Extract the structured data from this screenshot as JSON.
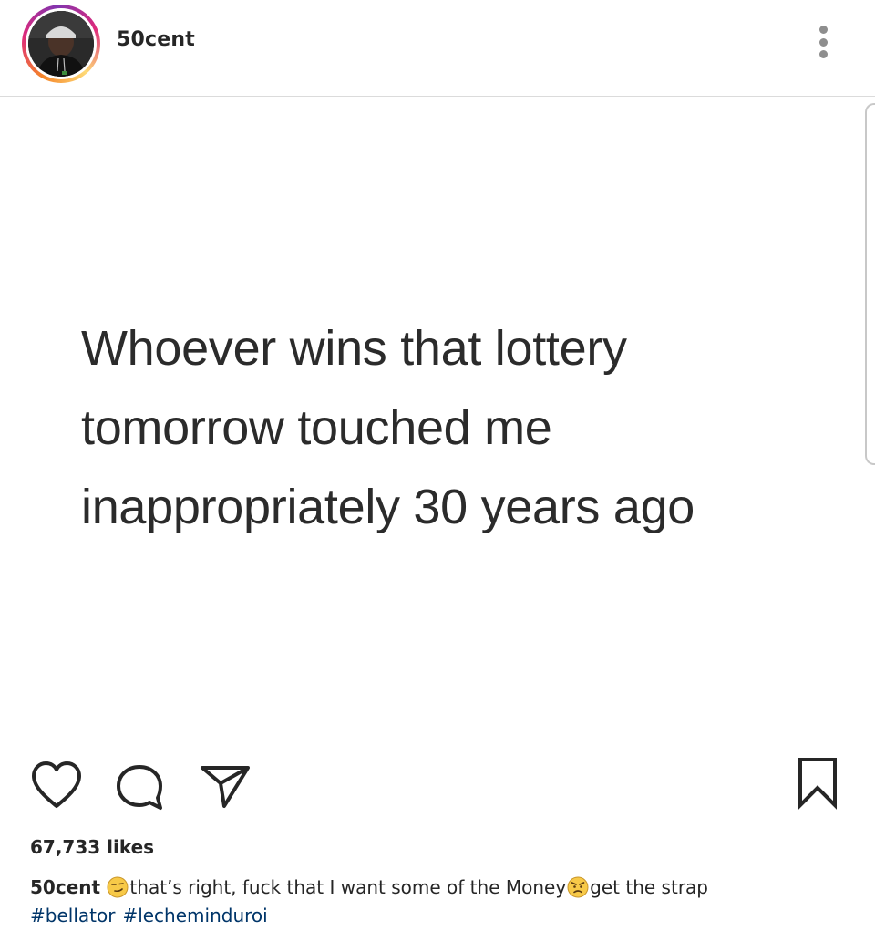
{
  "post": {
    "username": "50cent",
    "image_text_lines": [
      "Whoever wins that lottery",
      "tomorrow touched me",
      "inappropriately 30 years ago"
    ],
    "likes": "67,733 likes",
    "caption": {
      "username": "50cent",
      "part1": "that’s right, fuck that I want some of the Money",
      "part2": "get the strap",
      "emoji1": "smirk-emoji",
      "emoji2": "angry-emoji"
    },
    "hashtags": [
      "#bellator",
      "#lecheminduroi"
    ]
  },
  "icons": {
    "like": "heart-icon",
    "comment": "comment-icon",
    "share": "send-icon",
    "save": "bookmark-icon",
    "more": "more-vertical-icon"
  },
  "colors": {
    "hashtag": "#003569",
    "text": "#262626",
    "muted": "#8e8e8e",
    "story_ring": [
      "#f58529",
      "#dd2a7b",
      "#8134af"
    ]
  }
}
